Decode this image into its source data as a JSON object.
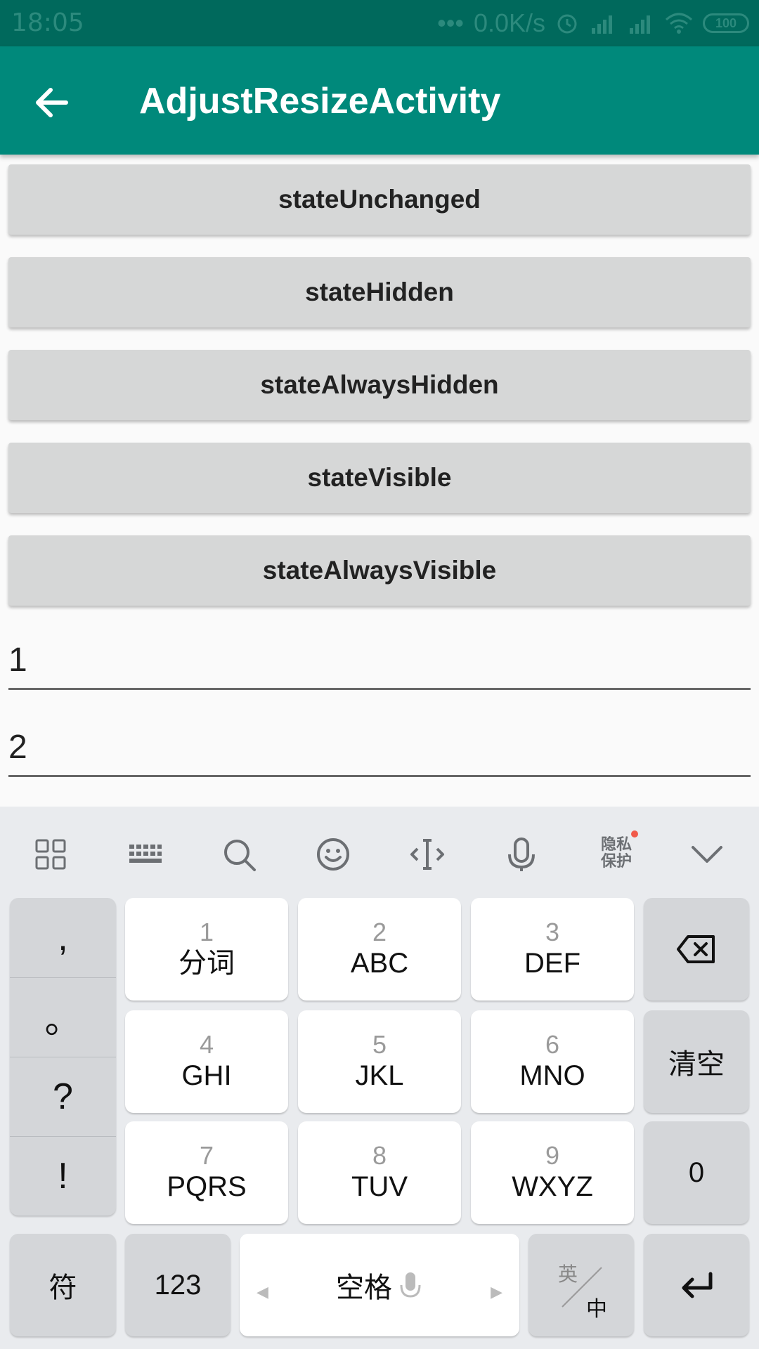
{
  "status_bar": {
    "time": "18:05",
    "net_speed": "0.0K/s",
    "battery": "100"
  },
  "toolbar": {
    "title": "AdjustResizeActivity"
  },
  "buttons": [
    {
      "label": "stateUnchanged"
    },
    {
      "label": "stateHidden"
    },
    {
      "label": "stateAlwaysHidden"
    },
    {
      "label": "stateVisible"
    },
    {
      "label": "stateAlwaysVisible"
    }
  ],
  "fields": [
    {
      "value": "1"
    },
    {
      "value": "2"
    }
  ],
  "keyboard": {
    "privacy_label": [
      "隐私",
      "保护"
    ],
    "punctuation": [
      ",",
      "。",
      "?",
      "!"
    ],
    "keys": [
      {
        "num": "1",
        "label": "分词"
      },
      {
        "num": "2",
        "label": "ABC"
      },
      {
        "num": "3",
        "label": "DEF"
      },
      {
        "num": "4",
        "label": "GHI"
      },
      {
        "num": "5",
        "label": "JKL"
      },
      {
        "num": "6",
        "label": "MNO"
      },
      {
        "num": "7",
        "label": "PQRS"
      },
      {
        "num": "8",
        "label": "TUV"
      },
      {
        "num": "9",
        "label": "WXYZ"
      }
    ],
    "clear_label": "清空",
    "zero_label": "0",
    "symbols_label": "符",
    "numbers_label": "123",
    "space_label": "空格",
    "lang_top": "英",
    "lang_bottom": "中"
  }
}
